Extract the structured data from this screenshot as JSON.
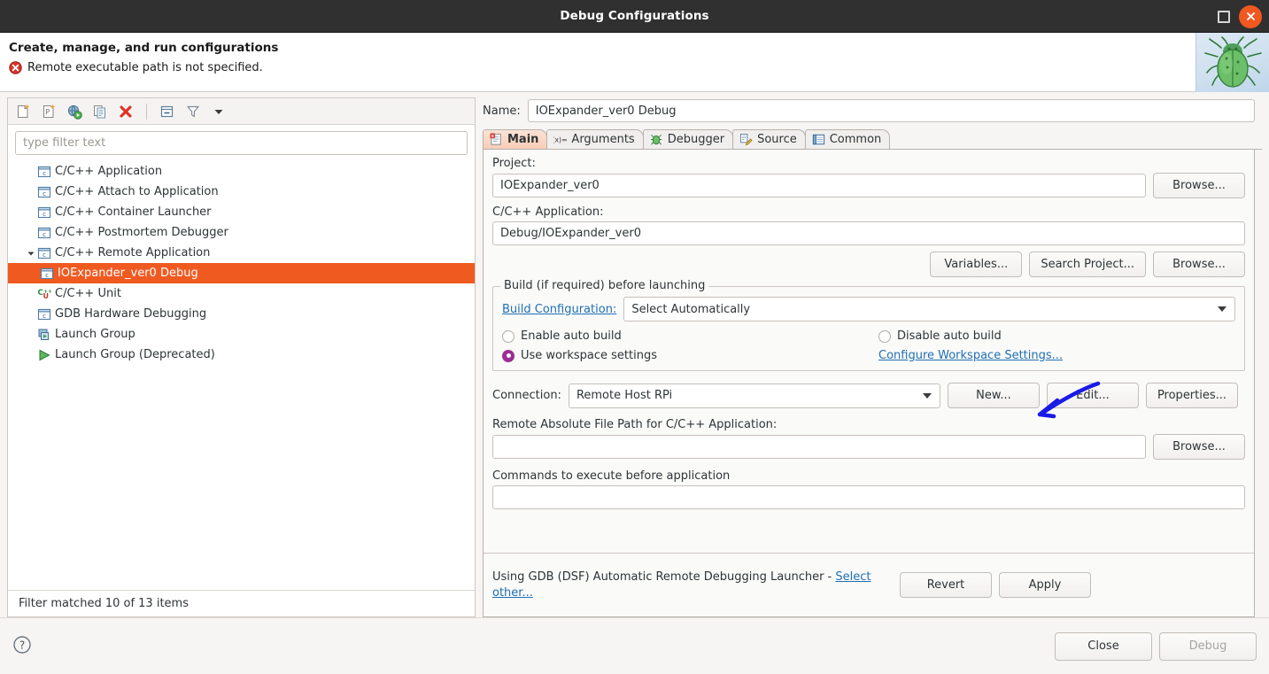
{
  "window": {
    "title": "Debug Configurations",
    "maximize_icon": "maximize-icon",
    "close_icon": "close-icon"
  },
  "header": {
    "title": "Create, manage, and run configurations",
    "message": "Remote executable path is not specified.",
    "message_icon": "error-icon",
    "mascot_icon": "bug-mascot-icon",
    "error_color": "#d6352b"
  },
  "left_toolbar": {
    "items": [
      {
        "name": "new-configuration-icon",
        "tooltip": "New launch configuration"
      },
      {
        "name": "new-prototype-icon",
        "tooltip": "New prototype"
      },
      {
        "name": "new-launch-group-icon",
        "tooltip": "New launch group"
      },
      {
        "name": "duplicate-icon",
        "tooltip": "Duplicate"
      },
      {
        "name": "delete-icon",
        "tooltip": "Delete"
      },
      {
        "name": "collapse-all-icon",
        "tooltip": "Collapse All"
      },
      {
        "name": "filter-icon",
        "tooltip": "Filter"
      },
      {
        "name": "view-menu-icon",
        "tooltip": "View Menu"
      }
    ]
  },
  "filter": {
    "placeholder": "type filter text",
    "value": ""
  },
  "tree": {
    "items": [
      {
        "label": "C/C++ Application",
        "icon": "c-config-icon",
        "level": 0,
        "expandable": false,
        "selected": false
      },
      {
        "label": "C/C++ Attach to Application",
        "icon": "c-config-icon",
        "level": 0,
        "expandable": false,
        "selected": false
      },
      {
        "label": "C/C++ Container Launcher",
        "icon": "c-config-icon",
        "level": 0,
        "expandable": false,
        "selected": false
      },
      {
        "label": "C/C++ Postmortem Debugger",
        "icon": "c-config-icon",
        "level": 0,
        "expandable": false,
        "selected": false
      },
      {
        "label": "C/C++ Remote Application",
        "icon": "c-config-icon",
        "level": 0,
        "expandable": true,
        "expanded": true,
        "selected": false
      },
      {
        "label": "IOExpander_ver0 Debug",
        "icon": "c-config-icon",
        "level": 1,
        "expandable": false,
        "selected": true
      },
      {
        "label": "C/C++ Unit",
        "icon": "cpp-unit-icon",
        "level": 0,
        "expandable": false,
        "selected": false
      },
      {
        "label": "GDB Hardware Debugging",
        "icon": "c-config-icon",
        "level": 0,
        "expandable": false,
        "selected": false
      },
      {
        "label": "Launch Group",
        "icon": "launch-group-icon",
        "level": 0,
        "expandable": false,
        "selected": false
      },
      {
        "label": "Launch Group (Deprecated)",
        "icon": "launch-group-deprecated-icon",
        "level": 0,
        "expandable": false,
        "selected": false
      }
    ],
    "selection_color": "#ef5a21",
    "status": "Filter matched 10 of 13 items"
  },
  "config": {
    "name_label": "Name:",
    "name_value": "IOExpander_ver0 Debug",
    "tabs": [
      {
        "label": "Main",
        "icon": "main-tab-icon",
        "active": true
      },
      {
        "label": "Arguments",
        "icon": "arguments-tab-icon",
        "active": false
      },
      {
        "label": "Debugger",
        "icon": "debugger-tab-icon",
        "active": false
      },
      {
        "label": "Source",
        "icon": "source-tab-icon",
        "active": false
      },
      {
        "label": "Common",
        "icon": "common-tab-icon",
        "active": false
      }
    ],
    "project": {
      "label": "Project:",
      "value": "IOExpander_ver0",
      "browse_label": "Browse..."
    },
    "application": {
      "label": "C/C++ Application:",
      "value": "Debug/IOExpander_ver0",
      "variables_label": "Variables...",
      "search_project_label": "Search Project...",
      "browse_label": "Browse..."
    },
    "build_group": {
      "title": "Build (if required) before launching",
      "build_config_link": "Build Configuration:",
      "build_config_value": "Select Automatically",
      "radio_enable_auto_build": "Enable auto build",
      "radio_disable_auto_build": "Disable auto build",
      "radio_use_workspace_settings": "Use workspace settings",
      "configure_workspace_link": "Configure Workspace Settings...",
      "selected_radio": "use_workspace_settings",
      "radio_accent": "#9c2f93"
    },
    "connection": {
      "label": "Connection:",
      "value": "Remote Host RPi",
      "new_label": "New...",
      "edit_label": "Edit...",
      "properties_label": "Properties..."
    },
    "remote_path": {
      "label": "Remote Absolute File Path for C/C++ Application:",
      "value": "",
      "browse_label": "Browse..."
    },
    "commands": {
      "label": "Commands to execute before application",
      "value": ""
    },
    "launcher": {
      "text_prefix": "Using GDB (DSF) Automatic Remote Debugging Launcher - ",
      "link_text": "Select other...",
      "link_color": "#1f6fb4"
    },
    "revert_label": "Revert",
    "apply_label": "Apply"
  },
  "bottom_bar": {
    "help_icon": "help-icon",
    "close_label": "Close",
    "debug_label": "Debug",
    "debug_disabled": true
  },
  "annotation": {
    "arrow_icon": "annotation-arrow-icon",
    "color": "#1a1ae6",
    "points_to": "New..."
  }
}
